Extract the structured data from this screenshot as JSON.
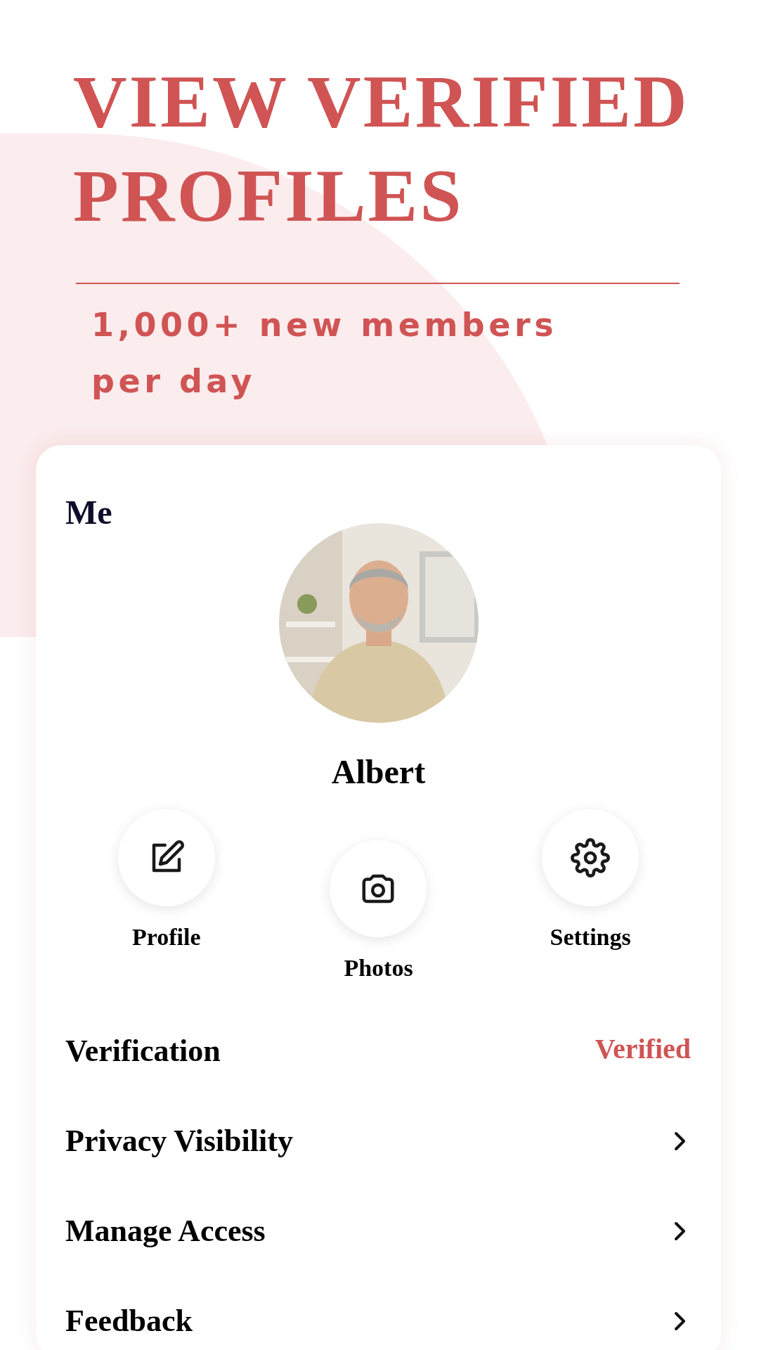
{
  "headline_lines": [
    "VIEW VERIFIED",
    "PROFILES"
  ],
  "subheadline": "1,000+ new members per day",
  "screen": {
    "title": "Me",
    "name": "Albert",
    "actions": [
      {
        "label": "Profile",
        "kind": "edit"
      },
      {
        "label": "Photos",
        "kind": "camera"
      },
      {
        "label": "Settings",
        "kind": "settings"
      }
    ],
    "menu": [
      {
        "label": "Verification",
        "kind": "status",
        "status": "Verified"
      },
      {
        "label": "Privacy Visibility",
        "kind": "link"
      },
      {
        "label": "Manage Access",
        "kind": "link"
      },
      {
        "label": "Feedback",
        "kind": "link"
      }
    ]
  }
}
